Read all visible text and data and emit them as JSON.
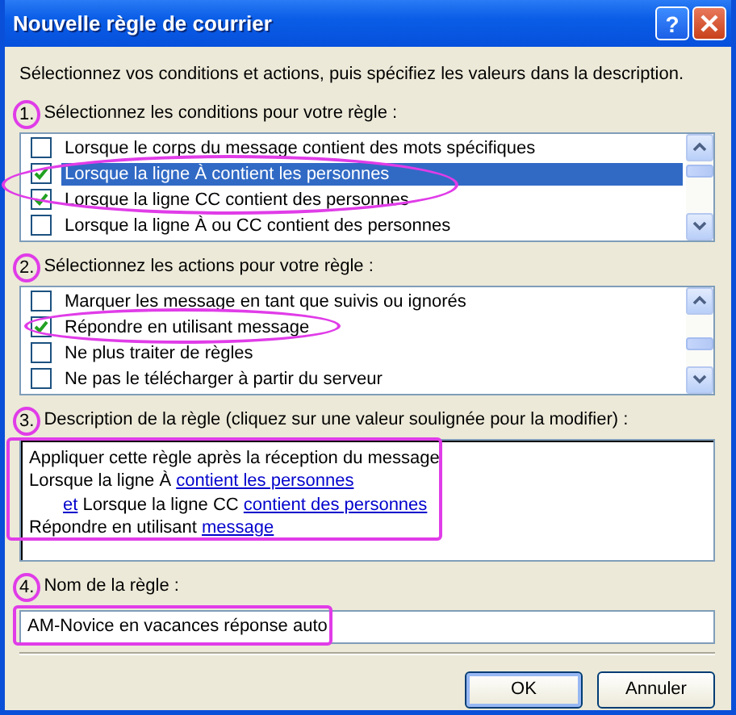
{
  "window": {
    "title": "Nouvelle règle de courrier",
    "help": "?"
  },
  "intro": "Sélectionnez vos conditions et actions, puis spécifiez les valeurs dans la description.",
  "conditions": {
    "number": "1.",
    "label": "Sélectionnez les conditions pour votre règle :",
    "items": [
      {
        "label": "Lorsque le corps du message contient des mots spécifiques",
        "checked": false,
        "selected": false
      },
      {
        "label": "Lorsque la ligne À contient les personnes",
        "checked": true,
        "selected": true
      },
      {
        "label": "Lorsque la ligne CC contient des personnes",
        "checked": true,
        "selected": false
      },
      {
        "label": "Lorsque la ligne À ou CC contient des personnes",
        "checked": false,
        "selected": false
      }
    ]
  },
  "actions": {
    "number": "2.",
    "label": "Sélectionnez les actions pour votre règle :",
    "items": [
      {
        "label": "Marquer les message en tant que suivis ou ignorés",
        "checked": false,
        "selected": false
      },
      {
        "label": "Répondre en utilisant message",
        "checked": true,
        "selected": false
      },
      {
        "label": "Ne plus traiter de règles",
        "checked": false,
        "selected": false
      },
      {
        "label": "Ne pas le télécharger à partir du serveur",
        "checked": false,
        "selected": false
      }
    ]
  },
  "description": {
    "number": "3.",
    "label": "Description de la règle (cliquez sur une valeur soulignée pour la modifier) :",
    "lines": [
      {
        "indented": false,
        "parts": [
          {
            "text": "Appliquer cette règle après la réception du message",
            "link": false
          }
        ]
      },
      {
        "indented": false,
        "parts": [
          {
            "text": "Lorsque la ligne À ",
            "link": false
          },
          {
            "text": "contient les personnes",
            "link": true
          }
        ]
      },
      {
        "indented": true,
        "parts": [
          {
            "text": "et",
            "link": true
          },
          {
            "text": " Lorsque la ligne CC ",
            "link": false
          },
          {
            "text": "contient des personnes",
            "link": true
          }
        ]
      },
      {
        "indented": false,
        "parts": [
          {
            "text": "Répondre en utilisant ",
            "link": false
          },
          {
            "text": "message",
            "link": true
          }
        ]
      }
    ]
  },
  "rule_name": {
    "number": "4.",
    "label": "Nom de la règle :",
    "value": "AM-Novice en vacances réponse auto"
  },
  "buttons": [
    {
      "label": "OK",
      "default": true
    },
    {
      "label": "Annuler",
      "default": false
    }
  ]
}
